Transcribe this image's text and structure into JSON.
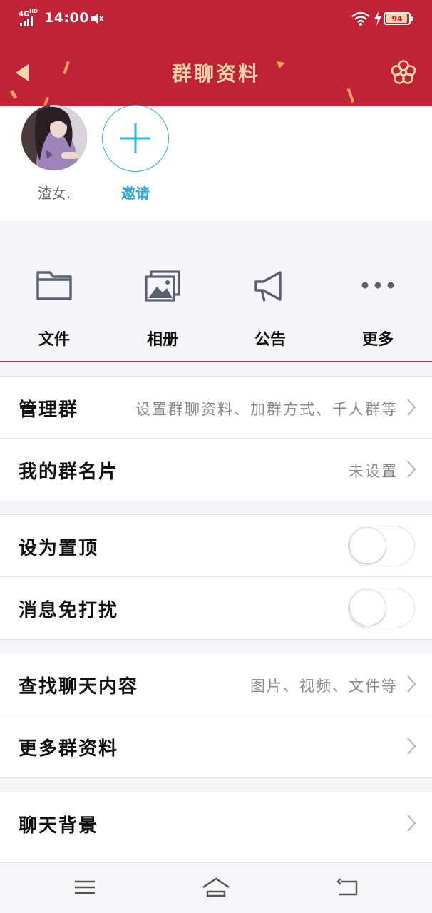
{
  "status_bar": {
    "network": "4G",
    "network_sub": "HD",
    "time": "14:00",
    "battery": "94",
    "battery_level_percent": 94
  },
  "header": {
    "title": "群聊资料",
    "background_color": "#bf2436",
    "title_color": "#f9d6aa"
  },
  "members": {
    "items": [
      {
        "name": "渣女."
      }
    ],
    "invite_label": "邀请",
    "invite_color": "#2ea8d0"
  },
  "features": [
    {
      "label": "文件",
      "icon": "folder-icon"
    },
    {
      "label": "相册",
      "icon": "photo-album-icon"
    },
    {
      "label": "公告",
      "icon": "megaphone-icon"
    },
    {
      "label": "更多",
      "icon": "more-dots-icon"
    }
  ],
  "settings": {
    "manage_group": {
      "label": "管理群",
      "value": "设置群聊资料、加群方式、千人群等"
    },
    "my_group_card": {
      "label": "我的群名片",
      "value": "未设置"
    },
    "pin_to_top": {
      "label": "设为置顶",
      "on": false
    },
    "do_not_disturb": {
      "label": "消息免打扰",
      "on": false
    },
    "search_chat": {
      "label": "查找聊天内容",
      "value": "图片、视频、文件等"
    },
    "more_group_info": {
      "label": "更多群资料"
    },
    "chat_background": {
      "label": "聊天背景"
    }
  },
  "navbar": {
    "icons": [
      "menu-icon",
      "home-icon",
      "back-icon"
    ]
  }
}
